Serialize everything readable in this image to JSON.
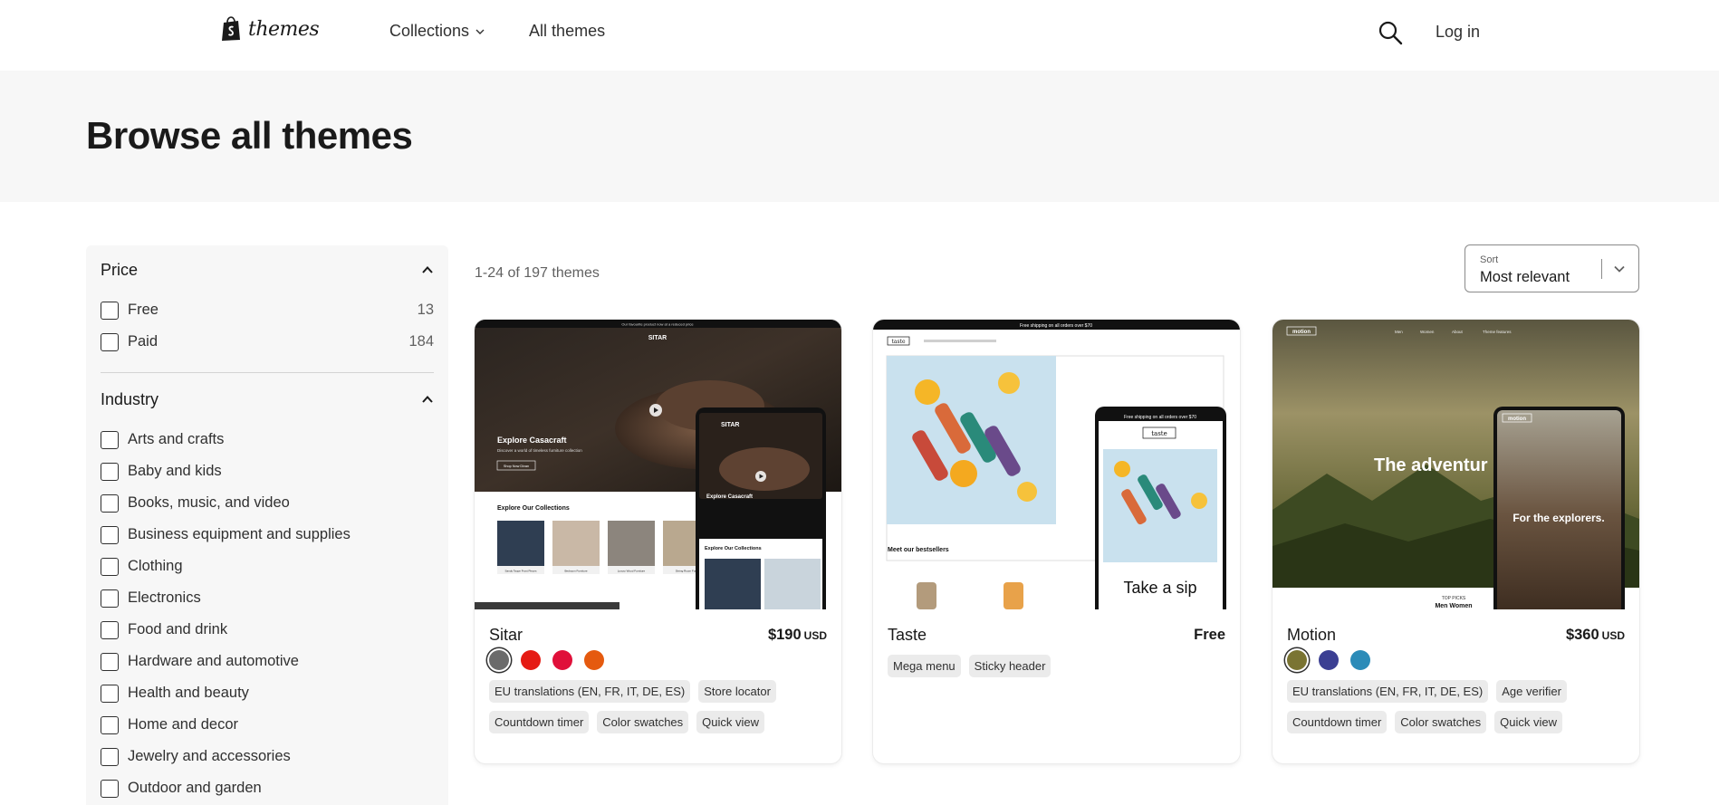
{
  "header": {
    "logo_text": "themes",
    "nav": [
      {
        "label": "Collections"
      },
      {
        "label": "All themes"
      }
    ],
    "login_label": "Log in",
    "icons": {
      "search": "search-icon",
      "logo": "shopify-bag-icon",
      "collections_chevron": "chevron-down-icon"
    }
  },
  "hero": {
    "title": "Browse all themes"
  },
  "sidebar": {
    "price": {
      "title": "Price",
      "options": [
        {
          "label": "Free",
          "count": "13"
        },
        {
          "label": "Paid",
          "count": "184"
        }
      ]
    },
    "industry": {
      "title": "Industry",
      "options": [
        {
          "label": "Arts and crafts"
        },
        {
          "label": "Baby and kids"
        },
        {
          "label": "Books, music, and video"
        },
        {
          "label": "Business equipment and supplies"
        },
        {
          "label": "Clothing"
        },
        {
          "label": "Electronics"
        },
        {
          "label": "Food and drink"
        },
        {
          "label": "Hardware and automotive"
        },
        {
          "label": "Health and beauty"
        },
        {
          "label": "Home and decor"
        },
        {
          "label": "Jewelry and accessories"
        },
        {
          "label": "Outdoor and garden"
        }
      ]
    }
  },
  "results": {
    "count_text": "1-24 of 197 themes",
    "sort": {
      "label": "Sort",
      "value": "Most relevant"
    }
  },
  "themes": [
    {
      "name": "Sitar",
      "price": "$190",
      "currency": "USD",
      "swatches": [
        "#6b6b6b",
        "#e51b14",
        "#e0103a",
        "#e55a0f"
      ],
      "tags": [
        "EU translations (EN, FR, IT, DE, ES)",
        "Store locator",
        "Countdown timer",
        "Color swatches",
        "Quick view"
      ],
      "preview": {
        "banner": "Our favourite product now at a reduced price",
        "brand": "SITAR",
        "hero_heading": "Explore Casacraft",
        "hero_sub": "Discover a world of timeless furniture collection",
        "cta": "Shop Now Divan",
        "section": "Explore Our Collections",
        "collections": [
          "Sandy Taupe Frost Pieces",
          "Bedroom Furniture",
          "Luxury Wood Furniture",
          "Dining Room Furn"
        ],
        "mobile_brand": "SITAR",
        "mobile_heading": "Explore Casacraft",
        "mobile_section": "Explore Our Collections"
      }
    },
    {
      "name": "Taste",
      "price": "Free",
      "currency": "",
      "swatches": [],
      "tags": [
        "Mega menu",
        "Sticky header"
      ],
      "preview": {
        "banner": "Free shipping on all orders over $70",
        "brand": "taste",
        "section": "Meet our bestsellers",
        "mobile_banner": "Free shipping on all orders over $70",
        "mobile_brand": "taste",
        "mobile_heading": "Take a sip"
      }
    },
    {
      "name": "Motion",
      "price": "$360",
      "currency": "USD",
      "swatches": [
        "#7a7432",
        "#3b3f93",
        "#2b8bb8"
      ],
      "tags": [
        "EU translations (EN, FR, IT, DE, ES)",
        "Age verifier",
        "Countdown timer",
        "Color swatches",
        "Quick view"
      ],
      "preview": {
        "brand": "motion",
        "nav": [
          "Men",
          "Women",
          "About",
          "Theme features"
        ],
        "hero_heading": "The adventur",
        "sub_label": "TOP PICKS",
        "sub_links": "Men   Women",
        "mobile_brand": "motion",
        "mobile_heading": "For the explorers."
      }
    }
  ]
}
